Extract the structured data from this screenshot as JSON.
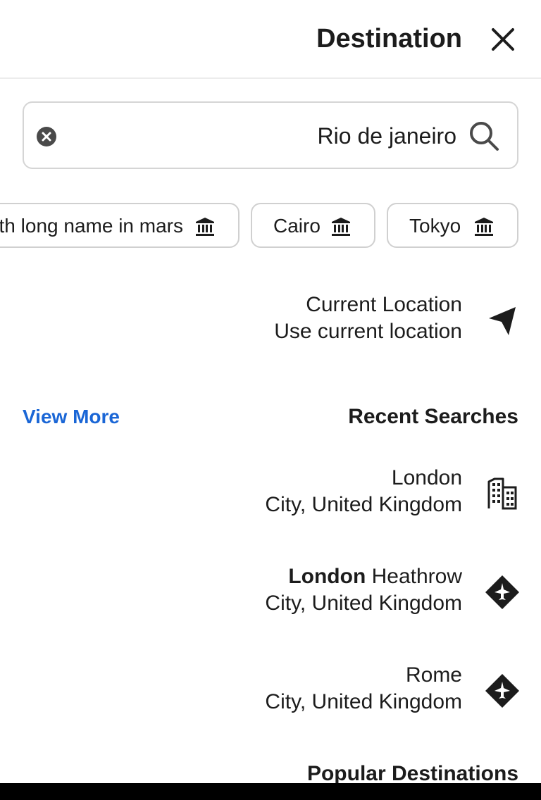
{
  "header": {
    "title": "Destination",
    "close_icon": "close-icon"
  },
  "search": {
    "value": "Rio de janeiro",
    "placeholder": "",
    "clear_icon": "clear-circle-icon",
    "search_icon": "search-icon"
  },
  "chips": [
    {
      "label": "th long name in mars",
      "icon": "museum-icon"
    },
    {
      "label": "Cairo",
      "icon": "museum-icon"
    },
    {
      "label": "Tokyo",
      "icon": "museum-icon"
    }
  ],
  "current_location": {
    "title": "Current Location",
    "subtitle": "Use current location",
    "icon": "navigation-arrow-icon"
  },
  "recent": {
    "title": "Recent Searches",
    "view_more": "View More",
    "items": [
      {
        "bold": "",
        "name": "London",
        "subtitle": "City, United Kingdom",
        "icon": "city-buildings-icon"
      },
      {
        "bold": "London",
        "name": " Heathrow",
        "subtitle": "City, United Kingdom",
        "icon": "airport-plane-icon"
      },
      {
        "bold": "",
        "name": "Rome",
        "subtitle": "City, United Kingdom",
        "icon": "airport-plane-icon"
      }
    ]
  },
  "popular": {
    "title": "Popular Destinations"
  },
  "colors": {
    "accent": "#1a66d6",
    "text": "#1c1c1c",
    "border": "#d5d5d5"
  }
}
